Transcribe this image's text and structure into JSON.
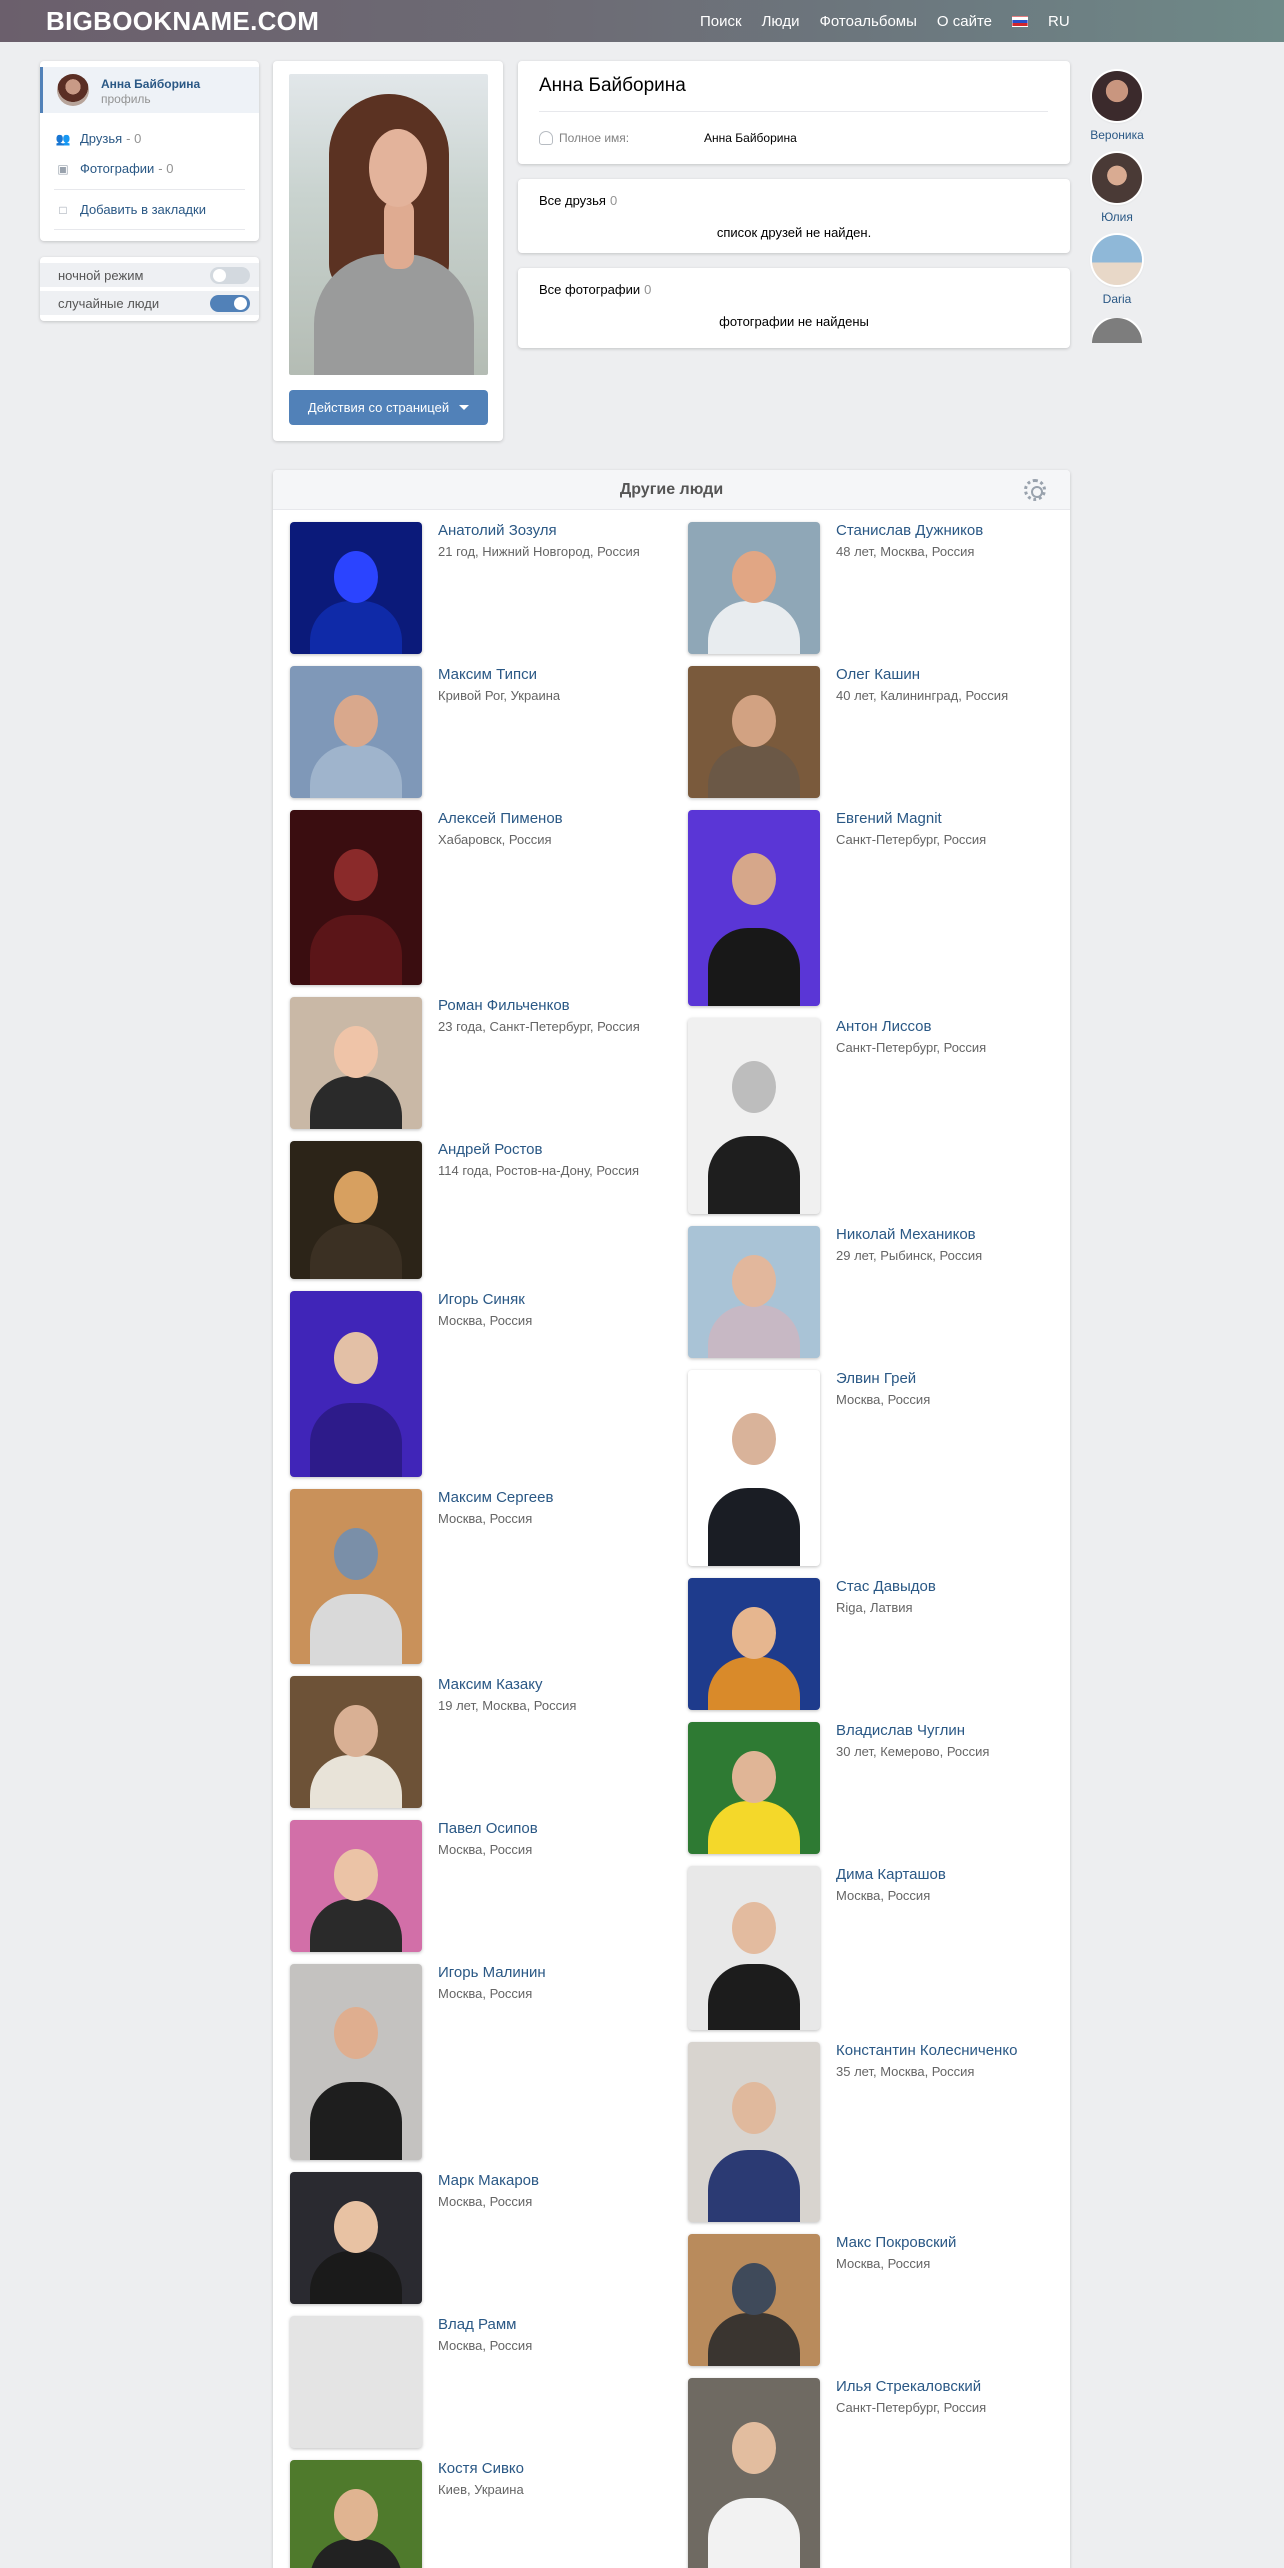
{
  "header": {
    "logo": "BIGBOOKNAME.COM",
    "nav": [
      "Поиск",
      "Люди",
      "Фотоальбомы",
      "О сайте"
    ],
    "lang": "RU"
  },
  "menu": {
    "name": "Анна Байборина",
    "sub": "профиль",
    "friends_label": "Друзья",
    "friends_count": "- 0",
    "photos_label": "Фотографии",
    "photos_count": "- 0",
    "bookmark_label": "Добавить в закладки"
  },
  "toggles": {
    "night_label": "ночной режим",
    "night_on": false,
    "random_label": "случайные люди",
    "random_on": true
  },
  "profile": {
    "action_button": "Действия со страницей",
    "name": "Анна Байборина",
    "full_name_label": "Полное имя:",
    "full_name_value": "Анна Байборина",
    "friends_title": "Все друзья",
    "friends_count": "0",
    "friends_empty": "список друзей не найден.",
    "photos_title": "Все фотографии",
    "photos_count": "0",
    "photos_empty": "фотографии не найдены"
  },
  "side_avatars": [
    {
      "name": "Вероника",
      "color": "#3b2a2c"
    },
    {
      "name": "Юлия",
      "color": "#4a3a36"
    },
    {
      "name": "Daria",
      "color": "#8fb8d8"
    },
    {
      "name": "",
      "color": "#7d7d7d"
    }
  ],
  "people": {
    "title": "Другие люди",
    "left": [
      {
        "name": "Анатолий Зозуля",
        "info": "21 год, Нижний Новгород, Россия",
        "bg": "#0b1a7a",
        "fc": "#2b44ff",
        "tr": "#0f2aa8"
      },
      {
        "name": "Максим Типси",
        "info": "Кривой Рог, Украина",
        "bg": "#7f98b8",
        "fc": "#d9a88c",
        "tr": "#9fb4cc"
      },
      {
        "name": "Алексей Пименов",
        "info": "Хабаровск, Россия",
        "bg": "#3a0d10",
        "fc": "#8a2a2a",
        "tr": "#5b1518"
      },
      {
        "name": "Роман Фильченков",
        "info": "23 года, Санкт-Петербург, Россия",
        "bg": "#c9b8a6",
        "fc": "#efc4a8",
        "tr": "#2a2a2a"
      },
      {
        "name": "Андрей Ростов",
        "info": "114 года, Ростов-на-Дону, Россия",
        "bg": "#2c2418",
        "fc": "#d7a060",
        "tr": "#3b3023"
      },
      {
        "name": "Игорь Синяк",
        "info": "Москва, Россия",
        "bg": "#4025b8",
        "fc": "#e3c0a6",
        "tr": "#2d1b8a"
      },
      {
        "name": "Максим Сергеев",
        "info": "Москва, Россия",
        "bg": "#c9915a",
        "fc": "#7a8fa8",
        "tr": "#d9d9d9"
      },
      {
        "name": "Максим Казаку",
        "info": "19 лет, Москва, Россия",
        "bg": "#6d5237",
        "fc": "#d9b094",
        "tr": "#e8e3d8"
      },
      {
        "name": "Павел Осипов",
        "info": "Москва, Россия",
        "bg": "#d26fa8",
        "fc": "#ebc3a6",
        "tr": "#2a2a2a"
      },
      {
        "name": "Игорь Малинин",
        "info": "Москва, Россия",
        "bg": "#c4c2c0",
        "fc": "#dfae8f",
        "tr": "#1e1e1e"
      },
      {
        "name": "Марк Макаров",
        "info": "Москва, Россия",
        "bg": "#2a2a30",
        "fc": "#e8c2a3",
        "tr": "#1a1a1a"
      },
      {
        "name": "Влад Рамм",
        "info": "Москва, Россия",
        "bg": "#e4e4e4",
        "fc": "#e4e4e4",
        "tr": "#e4e4e4"
      },
      {
        "name": "Костя Сивко",
        "info": "Киев, Украина",
        "bg": "#4f7a2c",
        "fc": "#e0b491",
        "tr": "#222"
      }
    ],
    "right": [
      {
        "name": "Станислав Дужников",
        "info": "48 лет, Москва, Россия",
        "bg": "#8fa7b7",
        "fc": "#e1a684",
        "tr": "#e8ecef"
      },
      {
        "name": "Олег Кашин",
        "info": "40 лет, Калининград, Россия",
        "bg": "#7a5a3c",
        "fc": "#d2a282",
        "tr": "#6b5846"
      },
      {
        "name": "Евгений Magnit",
        "info": "Санкт-Петербург, Россия",
        "bg": "#5a36d6",
        "fc": "#d6a78a",
        "tr": "#181818"
      },
      {
        "name": "Антон Лиссов",
        "info": "Санкт-Петербург, Россия",
        "bg": "#f0f0f0",
        "fc": "#bdbdbd",
        "tr": "#1e1e1e"
      },
      {
        "name": "Николай Механиков",
        "info": "29 лет, Рыбинск, Россия",
        "bg": "#a9c3d6",
        "fc": "#e2b79c",
        "tr": "#c7b8c4"
      },
      {
        "name": "Элвин Грей",
        "info": "Москва, Россия",
        "bg": "#ffffff",
        "fc": "#d9b39a",
        "tr": "#1a1d24"
      },
      {
        "name": "Стас Давыдов",
        "info": "Riga, Латвия",
        "bg": "#1e3b8c",
        "fc": "#e6b68f",
        "tr": "#d98a2a"
      },
      {
        "name": "Владислав Чуглин",
        "info": "30 лет, Кемерово, Россия",
        "bg": "#2e7a33",
        "fc": "#e0b596",
        "tr": "#f4d82a"
      },
      {
        "name": "Дима Карташов",
        "info": "Москва, Россия",
        "bg": "#e8e8e8",
        "fc": "#e3bb9f",
        "tr": "#1c1c1c"
      },
      {
        "name": "Константин Колесниченко",
        "info": "35 лет, Москва, Россия",
        "bg": "#d8d4cf",
        "fc": "#e0b99d",
        "tr": "#2b3a73"
      },
      {
        "name": "Макс Покровский",
        "info": "Москва, Россия",
        "bg": "#b98b5c",
        "fc": "#3f4a5a",
        "tr": "#3a3530"
      },
      {
        "name": "Илья Стрекаловский",
        "info": "Санкт-Петербург, Россия",
        "bg": "#6f6a62",
        "fc": "#e2bd9f",
        "tr": "#f2f2f2"
      }
    ]
  }
}
